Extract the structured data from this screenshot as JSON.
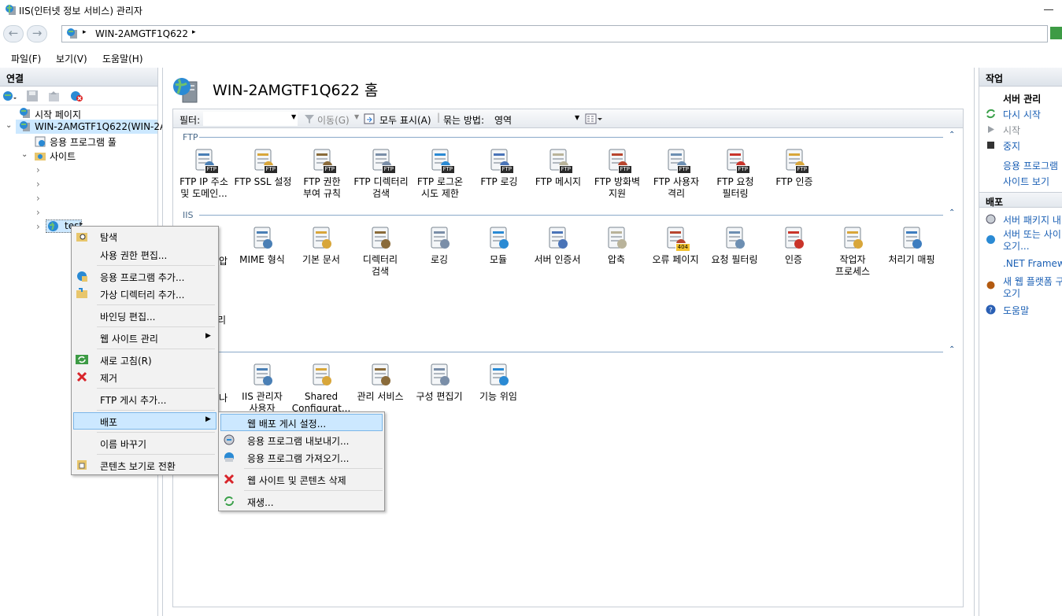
{
  "window": {
    "title": "IIS(인터넷 정보 서비스) 관리자"
  },
  "address": {
    "path": "WIN-2AMGTF1Q622",
    "arrow": "▸"
  },
  "menubar": {
    "file": "파일(F)",
    "view": "보기(V)",
    "help": "도움말(H)"
  },
  "connections": {
    "header": "연결",
    "start_page": "시작 페이지",
    "server": "WIN-2AMGTF1Q622(WIN-2A",
    "app_pools": "응용 프로그램 풀",
    "sites": "사이트",
    "site_test": "test"
  },
  "center": {
    "title": "WIN-2AMGTF1Q622 홈",
    "filter_label": "필터:",
    "go": "이동(G)",
    "show_all": "모두 표시(A)",
    "group_by": "묶는 방법:",
    "group_value": "영역",
    "groups": {
      "ftp": "FTP",
      "iis": "IIS"
    },
    "ftp_tiles": [
      {
        "l1": "FTP IP 주소",
        "l2": "및 도메인..."
      },
      {
        "l1": "FTP SSL 설정",
        "l2": ""
      },
      {
        "l1": "FTP 권한",
        "l2": "부여 규칙"
      },
      {
        "l1": "FTP 디렉터리",
        "l2": "검색"
      },
      {
        "l1": "FTP 로그온",
        "l2": "시도 제한"
      },
      {
        "l1": "FTP 로깅",
        "l2": ""
      },
      {
        "l1": "FTP 메시지",
        "l2": ""
      },
      {
        "l1": "FTP 방화벽",
        "l2": "지원"
      },
      {
        "l1": "FTP 사용자",
        "l2": "격리"
      },
      {
        "l1": "FTP 요청",
        "l2": "필터링"
      },
      {
        "l1": "FTP 인증",
        "l2": ""
      }
    ],
    "ftp_badge": "FTP",
    "iis_first_partial": "압",
    "iis_tiles": [
      {
        "l1": "MIME 형식",
        "l2": ""
      },
      {
        "l1": "기본 문서",
        "l2": ""
      },
      {
        "l1": "디렉터리",
        "l2": "검색"
      },
      {
        "l1": "로깅",
        "l2": ""
      },
      {
        "l1": "모듈",
        "l2": ""
      },
      {
        "l1": "서버 인증서",
        "l2": ""
      },
      {
        "l1": "압축",
        "l2": ""
      },
      {
        "l1": "오류 페이지",
        "l2": ""
      },
      {
        "l1": "요청 필터링",
        "l2": ""
      },
      {
        "l1": "인증",
        "l2": ""
      },
      {
        "l1": "작업자",
        "l2": "프로세스"
      },
      {
        "l1": "처리기 매핑",
        "l2": ""
      }
    ],
    "error_page_code": "404",
    "mgmt_partial": "리",
    "mgmt_first_partial": "나",
    "mgmt_tiles": [
      {
        "l1": "IIS 관리자",
        "l2": "사용자"
      },
      {
        "l1": "Shared",
        "l2": "Configurat..."
      },
      {
        "l1": "관리 서비스",
        "l2": ""
      },
      {
        "l1": "구성 편집기",
        "l2": ""
      },
      {
        "l1": "기능 위임",
        "l2": ""
      }
    ]
  },
  "actions": {
    "header": "작업",
    "server_manage": "서버 관리",
    "restart": "다시 시작",
    "start": "시작",
    "stop": "중지",
    "app_pools": "응용 프로그램",
    "sites": "사이트 보기",
    "deploy_header": "배포",
    "server_pkg": "서버 패키지 내",
    "server_or_site_1": "서버 또는 사이",
    "server_or_site_2": "오기...",
    "netfw": ".NET Framewo",
    "new_platform_1": "새 웹 플랫폼 구",
    "new_platform_2": "오기",
    "help": "도움말"
  },
  "context_menu": {
    "items": [
      "탐색",
      "사용 권한 편집...",
      "응용 프로그램 추가...",
      "가상 디렉터리 추가...",
      "바인딩 편집...",
      "웹 사이트 관리",
      "새로 고침(R)",
      "제거",
      "FTP 게시 추가...",
      "배포",
      "이름 바꾸기",
      "콘텐츠 보기로 전환"
    ]
  },
  "submenu": {
    "items": [
      "웹 배포 게시 설정...",
      "응용 프로그램 내보내기...",
      "응용 프로그램 가져오기...",
      "웹 사이트 및 콘텐츠 삭제",
      "재생..."
    ]
  }
}
